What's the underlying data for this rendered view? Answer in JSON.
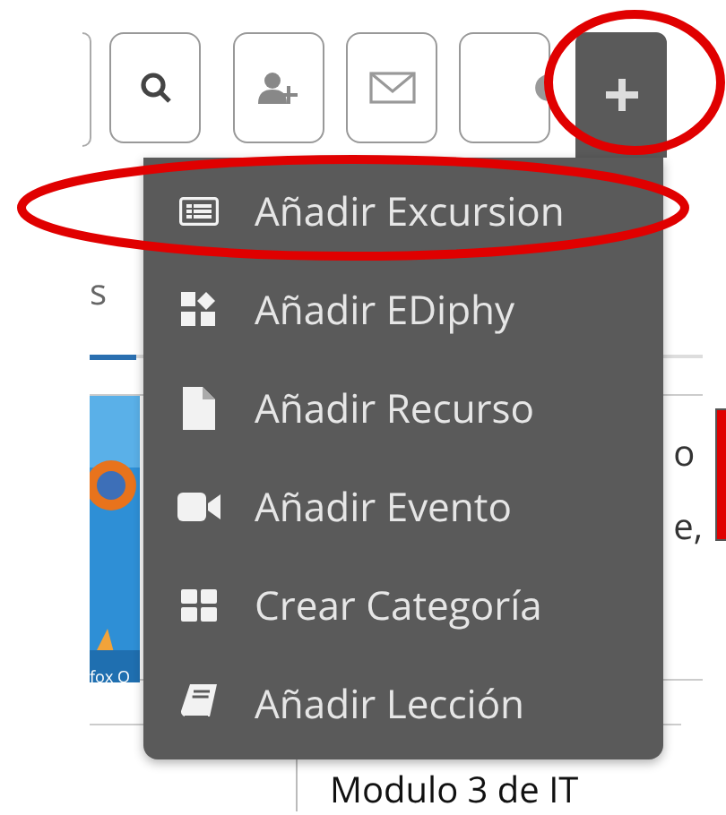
{
  "toolbar": {
    "buttons": [
      {
        "kind": "search",
        "active": false
      },
      {
        "kind": "add-user",
        "active": false
      },
      {
        "kind": "mail",
        "active": false
      },
      {
        "kind": "globe",
        "active": false
      },
      {
        "kind": "plus",
        "active": true
      }
    ]
  },
  "menu": {
    "items": [
      {
        "kind": "list",
        "label": "Añadir Excursion"
      },
      {
        "kind": "blocks",
        "label": "Añadir EDiphy"
      },
      {
        "kind": "file",
        "label": "Añadir Recurso"
      },
      {
        "kind": "video",
        "label": "Añadir Evento"
      },
      {
        "kind": "grid",
        "label": "Crear Categoría"
      },
      {
        "kind": "book",
        "label": "Añadir Lección"
      }
    ]
  },
  "background": {
    "tab_fragment": "s",
    "thumbnail_caption": "fox O",
    "title_fragments": [
      "o",
      "e,"
    ],
    "next_title": "Modulo 3 de IT"
  }
}
